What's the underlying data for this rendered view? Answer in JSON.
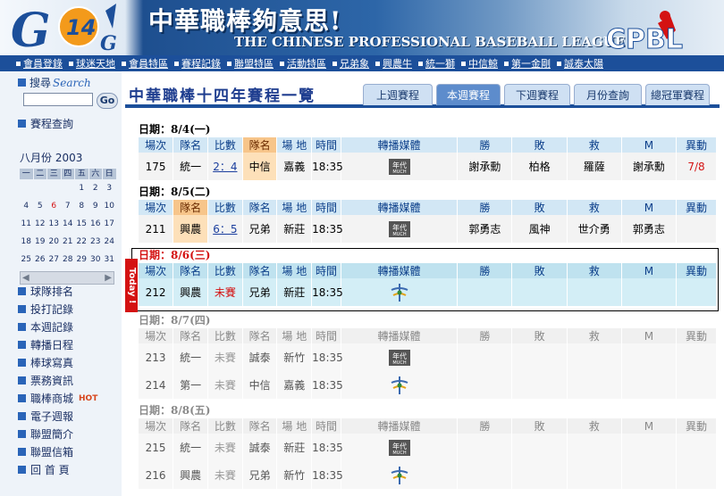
{
  "header": {
    "logo_text": "G 14 G",
    "title_cn": "中華職棒夠意思!",
    "title_en": "THE CHINESE PROFESSIONAL BASEBALL LEAGUE",
    "cpbl_logo": "CPBL"
  },
  "nav": [
    "會員登錄",
    "球迷天地",
    "會員特區",
    "賽程記錄",
    "聯盟特區",
    "活動特區",
    "兄弟象",
    "興農牛",
    "統一獅",
    "中信鯨",
    "第一金剛",
    "誠泰太陽"
  ],
  "sidebar": {
    "search_title": "搜尋",
    "search_title_en": "Search",
    "search_value": "",
    "go_label": "Go",
    "schedule_query": "賽程查詢",
    "calendar": {
      "month_label": "八月份 2003",
      "weekdays": [
        "一",
        "二",
        "三",
        "四",
        "五",
        "六",
        "日"
      ],
      "rows": [
        [
          "",
          "",
          "",
          "",
          "1",
          "2",
          "3"
        ],
        [
          "4",
          "5",
          "6",
          "7",
          "8",
          "9",
          "10"
        ],
        [
          "11",
          "12",
          "13",
          "14",
          "15",
          "16",
          "17"
        ],
        [
          "18",
          "19",
          "20",
          "21",
          "22",
          "23",
          "24"
        ],
        [
          "25",
          "26",
          "27",
          "28",
          "29",
          "30",
          "31"
        ]
      ],
      "highlight_day": "6"
    },
    "links": [
      "球隊排名",
      "投打記錄",
      "本週記錄",
      "轉播日程",
      "棒球寫真",
      "票務資訊",
      "職棒商城",
      "電子週報",
      "聯盟簡介",
      "聯盟信箱",
      "回 首 頁"
    ],
    "hot_label": "HOT"
  },
  "main": {
    "title": "中華職棒十四年賽程一覽",
    "tabs": [
      "上週賽程",
      "本週賽程",
      "下週賽程",
      "月份查詢",
      "總冠軍賽程"
    ],
    "active_tab": 1,
    "today_label": "Today !",
    "columns": [
      "場次",
      "隊名",
      "比數",
      "隊名",
      "場  地",
      "時間",
      "轉播媒體",
      "勝",
      "敗",
      "救",
      "M",
      "異動"
    ],
    "days": [
      {
        "date": "日期：8/4(一)",
        "games": [
          {
            "no": "175",
            "away": "統一",
            "score": "2：4",
            "home": "中信",
            "venue": "嘉義",
            "time": "18:35",
            "media": "年代",
            "w": "謝承勳",
            "l": "柏格",
            "s": "羅薩",
            "m": "謝承勳",
            "change": "7/8"
          }
        ]
      },
      {
        "date": "日期：8/5(二)",
        "games": [
          {
            "no": "211",
            "away": "興農",
            "score": "6：5",
            "home": "兄弟",
            "venue": "新莊",
            "time": "18:35",
            "media": "年代",
            "w": "郭勇志",
            "l": "風神",
            "s": "世介勇",
            "m": "郭勇志",
            "change": ""
          }
        ]
      },
      {
        "date": "日期：8/6(三)",
        "games": [
          {
            "no": "212",
            "away": "興農",
            "score": "未賽",
            "home": "兄弟",
            "venue": "新莊",
            "time": "18:35",
            "media": "緯來",
            "w": "",
            "l": "",
            "s": "",
            "m": "",
            "change": ""
          }
        ]
      },
      {
        "date": "日期：8/7(四)",
        "games": [
          {
            "no": "213",
            "away": "統一",
            "score": "未賽",
            "home": "誠泰",
            "venue": "新竹",
            "time": "18:35",
            "media": "年代",
            "w": "",
            "l": "",
            "s": "",
            "m": "",
            "change": ""
          },
          {
            "no": "214",
            "away": "第一",
            "score": "未賽",
            "home": "中信",
            "venue": "嘉義",
            "time": "18:35",
            "media": "緯來",
            "w": "",
            "l": "",
            "s": "",
            "m": "",
            "change": ""
          }
        ]
      },
      {
        "date": "日期：8/8(五)",
        "games": [
          {
            "no": "215",
            "away": "統一",
            "score": "未賽",
            "home": "誠泰",
            "venue": "新莊",
            "time": "18:35",
            "media": "年代",
            "w": "",
            "l": "",
            "s": "",
            "m": "",
            "change": ""
          },
          {
            "no": "216",
            "away": "興農",
            "score": "未賽",
            "home": "兄弟",
            "venue": "新竹",
            "time": "18:35",
            "media": "緯來",
            "w": "",
            "l": "",
            "s": "",
            "m": "",
            "change": ""
          }
        ]
      }
    ]
  },
  "colors": {
    "nav_bg": "#1c4f9a",
    "header_blue": "#d2e7f5",
    "highlight_orange": "#f7c58a",
    "today_red": "#d41212",
    "link_blue": "#1c3f9e"
  }
}
